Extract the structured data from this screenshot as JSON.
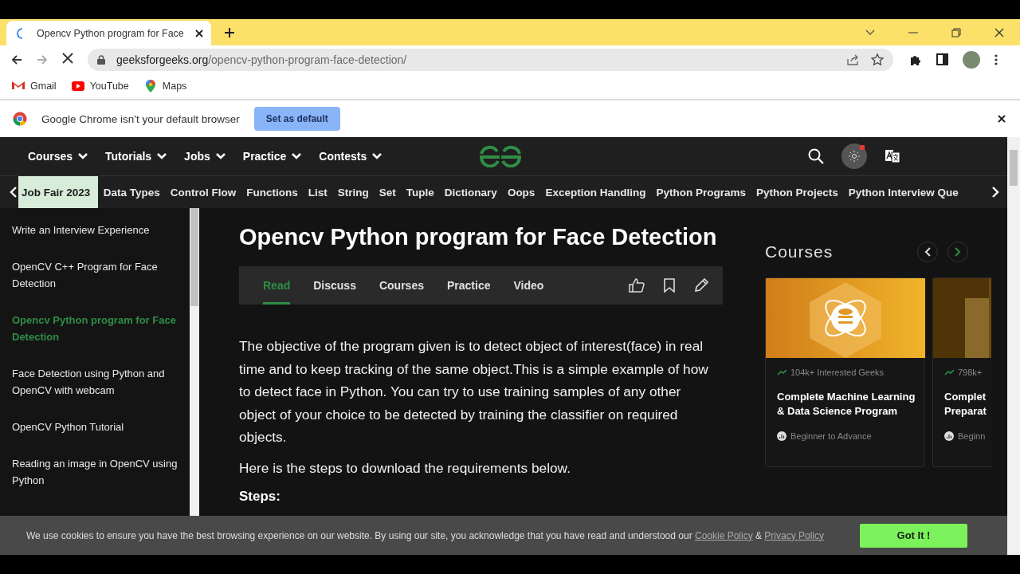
{
  "browser": {
    "tab": {
      "title": "Opencv Python program for Face",
      "loading": true
    },
    "address": {
      "domain": "geeksforgeeks.org",
      "path": "/opencv-python-program-face-detection/"
    },
    "bookmarks": [
      {
        "label": "Gmail",
        "kind": "gmail"
      },
      {
        "label": "YouTube",
        "kind": "youtube"
      },
      {
        "label": "Maps",
        "kind": "maps"
      }
    ],
    "infobar": {
      "message": "Google Chrome isn't your default browser",
      "button": "Set as default"
    }
  },
  "site": {
    "nav": [
      "Courses",
      "Tutorials",
      "Jobs",
      "Practice",
      "Contests"
    ],
    "subnav": [
      {
        "label": "Job Fair 2023",
        "selected": true
      },
      {
        "label": "Data Types",
        "selected": false
      },
      {
        "label": "Control Flow",
        "selected": false
      },
      {
        "label": "Functions",
        "selected": false
      },
      {
        "label": "List",
        "selected": false
      },
      {
        "label": "String",
        "selected": false
      },
      {
        "label": "Set",
        "selected": false
      },
      {
        "label": "Tuple",
        "selected": false
      },
      {
        "label": "Dictionary",
        "selected": false
      },
      {
        "label": "Oops",
        "selected": false
      },
      {
        "label": "Exception Handling",
        "selected": false
      },
      {
        "label": "Python Programs",
        "selected": false
      },
      {
        "label": "Python Projects",
        "selected": false
      },
      {
        "label": "Python Interview Que",
        "selected": false
      }
    ],
    "sidebar": {
      "items": [
        {
          "label": "Write an Interview Experience",
          "selected": false
        },
        {
          "label": "OpenCV C++ Program for Face Detection",
          "selected": false
        },
        {
          "label": "Opencv Python program for Face Detection",
          "selected": true
        },
        {
          "label": "Face Detection using Python and OpenCV with webcam",
          "selected": false
        },
        {
          "label": "OpenCV Python Tutorial",
          "selected": false
        },
        {
          "label": "Reading an image in OpenCV using Python",
          "selected": false
        }
      ]
    },
    "article": {
      "title": "Opencv Python program for Face Detection",
      "tabs": [
        {
          "label": "Read",
          "selected": true
        },
        {
          "label": "Discuss",
          "selected": false
        },
        {
          "label": "Courses",
          "selected": false
        },
        {
          "label": "Practice",
          "selected": false
        },
        {
          "label": "Video",
          "selected": false
        }
      ],
      "paragraphs": [
        "The objective of the program given is to detect object of interest(face) in real time and to keep tracking of the same object.This is a simple example of how to detect face in Python. You can try to use training samples of any other object of your choice to be detected by training the classifier on required objects.",
        "Here is the steps to download the requirements below."
      ],
      "heading": "Steps:"
    },
    "courses": {
      "title": "Courses",
      "cards": [
        {
          "interest": "104k+ Interested Geeks",
          "title_lines": [
            "Complete Machine Learning",
            "& Data Science Program"
          ],
          "difficulty": "Beginner to Advance",
          "kind": "full"
        },
        {
          "interest": "798k+",
          "title_lines": [
            "Complet",
            "Preparat"
          ],
          "difficulty": "Beginn",
          "kind": "partial"
        }
      ]
    },
    "cookie": {
      "text": "We use cookies to ensure you have the best browsing experience on our website. By using our site, you acknowledge that you have read and understood our",
      "links": [
        "Cookie Policy",
        "Privacy Policy"
      ],
      "joiner": "&",
      "button": "Got It !"
    }
  }
}
